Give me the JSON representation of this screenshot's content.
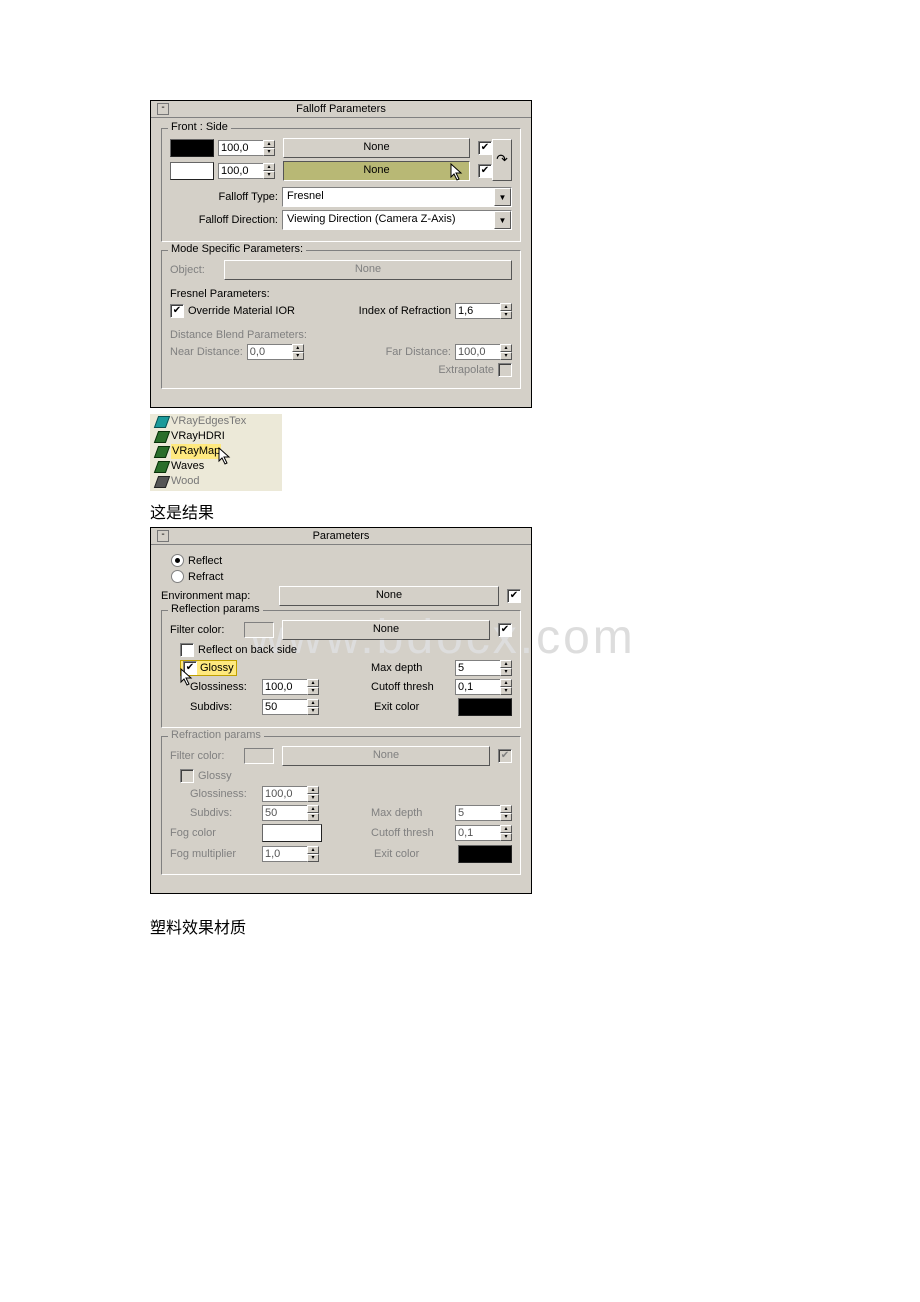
{
  "watermark": "www.bdocx.com",
  "falloff": {
    "title": "Falloff Parameters",
    "front_side": "Front : Side",
    "slot1": {
      "value": "100,0",
      "map": "None",
      "enabled": true
    },
    "slot2": {
      "value": "100,0",
      "map": "None",
      "enabled": true
    },
    "falloff_type_label": "Falloff Type:",
    "falloff_type_value": "Fresnel",
    "falloff_dir_label": "Falloff Direction:",
    "falloff_dir_value": "Viewing Direction (Camera Z-Axis)",
    "mode_specific": "Mode Specific Parameters:",
    "object_label": "Object:",
    "object_value": "None",
    "fresnel_params": "Fresnel Parameters:",
    "override_ior": "Override Material IOR",
    "ior_label": "Index of Refraction",
    "ior_value": "1,6",
    "dist_blend": "Distance Blend Parameters:",
    "near_label": "Near Distance:",
    "near_value": "0,0",
    "far_label": "Far Distance:",
    "far_value": "100,0",
    "extrapolate": "Extrapolate"
  },
  "browser": {
    "items": [
      "VRayEdgesTex",
      "VRayHDRI",
      "VRayMap",
      "Waves",
      "Wood"
    ]
  },
  "caption1": "这是结果",
  "caption2": "塑料效果材质",
  "vraymap": {
    "title": "Parameters",
    "reflect": "Reflect",
    "refract": "Refract",
    "env_map_label": "Environment map:",
    "env_map_value": "None",
    "refl_group": "Reflection params",
    "filter_color": "Filter color:",
    "filter_map": "None",
    "reflect_back": "Reflect on back side",
    "glossy": "Glossy",
    "glossiness_label": "Glossiness:",
    "glossiness_value": "100,0",
    "subdivs_label": "Subdivs:",
    "subdivs_value": "50",
    "max_depth_label": "Max depth",
    "max_depth_value": "5",
    "cutoff_label": "Cutoff thresh",
    "cutoff_value": "0,1",
    "exit_color": "Exit color",
    "refr_group": "Refraction params",
    "r_filter_map": "None",
    "r_glossy": "Glossy",
    "r_glossiness_value": "100,0",
    "r_subdivs_value": "50",
    "r_max_depth_value": "5",
    "r_cutoff_value": "0,1",
    "fog_color": "Fog color",
    "fog_mult": "Fog multiplier",
    "fog_mult_value": "1,0"
  }
}
